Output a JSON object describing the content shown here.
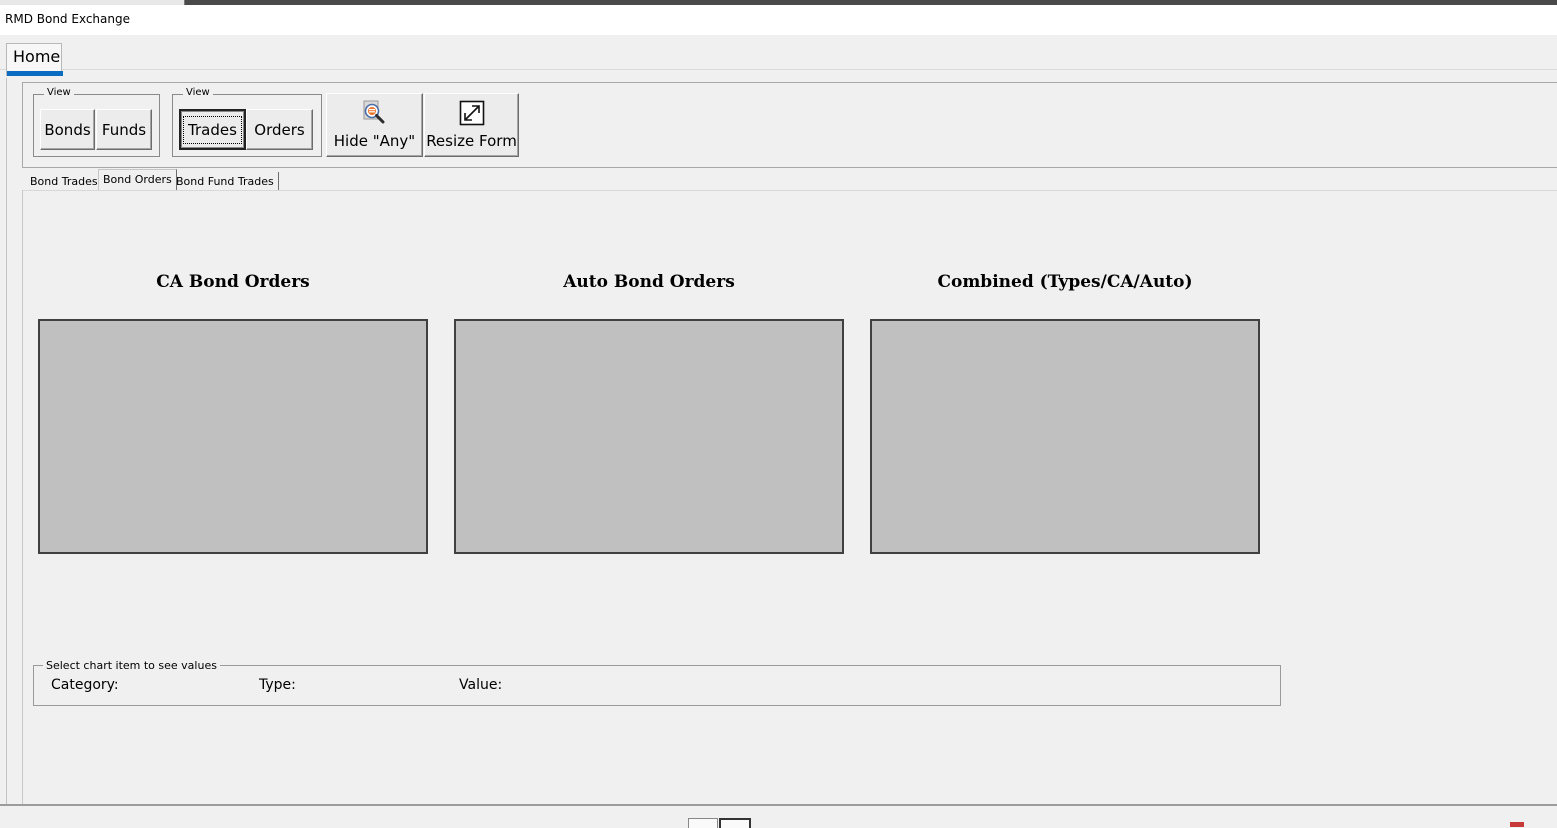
{
  "window": {
    "title": "RMD Bond Exchange"
  },
  "ribbon": {
    "home_tab": "Home",
    "group1": {
      "label": "View",
      "bonds": "Bonds",
      "funds": "Funds"
    },
    "group2": {
      "label": "View",
      "trades": "Trades",
      "orders": "Orders"
    },
    "hide_any": "Hide \"Any\"",
    "resize_form": "Resize Form"
  },
  "tabs": [
    "Bond Trades",
    "Bond Orders",
    "Bond Fund Trades"
  ],
  "active_tab": "Bond Orders",
  "charts": [
    {
      "title": "CA Bond Orders"
    },
    {
      "title": "Auto Bond Orders"
    },
    {
      "title": "Combined (Types/CA/Auto)"
    }
  ],
  "values_panel": {
    "label": "Select chart item to see values",
    "category": "Category:",
    "type": "Type:",
    "value": "Value:"
  },
  "colors": {
    "accent": "#0a6dc2",
    "chart_bg": "#c0c0c0",
    "window_bg": "#f0f0f0"
  }
}
